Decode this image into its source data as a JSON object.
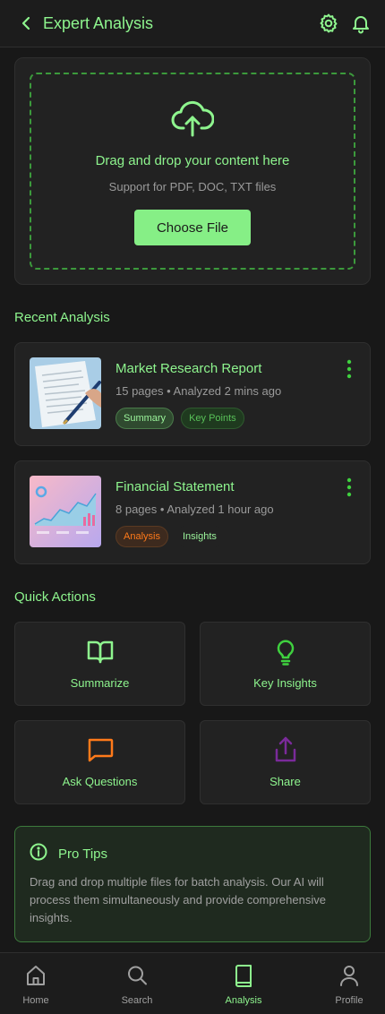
{
  "header": {
    "title": "Expert Analysis"
  },
  "upload": {
    "title": "Drag and drop your content here",
    "subtitle": "Support for PDF, DOC, TXT files",
    "button_label": "Choose File"
  },
  "recent": {
    "heading": "Recent Analysis",
    "items": [
      {
        "title": "Market Research Report",
        "meta": "15 pages • Analyzed 2 mins ago",
        "tags": [
          "Summary",
          "Key Points"
        ]
      },
      {
        "title": "Financial Statement",
        "meta": "8 pages • Analyzed 1 hour ago",
        "tags": [
          "Analysis",
          "Insights"
        ]
      }
    ]
  },
  "quick_actions": {
    "heading": "Quick Actions",
    "items": [
      {
        "label": "Summarize",
        "icon": "book-open-icon",
        "color": "#8ef58e"
      },
      {
        "label": "Key Insights",
        "icon": "lightbulb-icon",
        "color": "#3fd13f"
      },
      {
        "label": "Ask Questions",
        "icon": "message-square-icon",
        "color": "#ff7a1a"
      },
      {
        "label": "Share",
        "icon": "share-icon",
        "color": "#7a2a9a"
      }
    ]
  },
  "tips": {
    "title": "Pro Tips",
    "body": "Drag and drop multiple files for batch analysis. Our AI will process them simultaneously and provide comprehensive insights."
  },
  "nav": {
    "items": [
      {
        "label": "Home",
        "icon": "home-icon",
        "active": false
      },
      {
        "label": "Search",
        "icon": "search-icon",
        "active": false
      },
      {
        "label": "Analysis",
        "icon": "book-icon",
        "active": true
      },
      {
        "label": "Profile",
        "icon": "user-icon",
        "active": false
      }
    ]
  },
  "colors": {
    "accent": "#8ef58e",
    "button": "#86ef86",
    "background": "#181818",
    "card": "#222222",
    "orange": "#ff7a1a"
  }
}
